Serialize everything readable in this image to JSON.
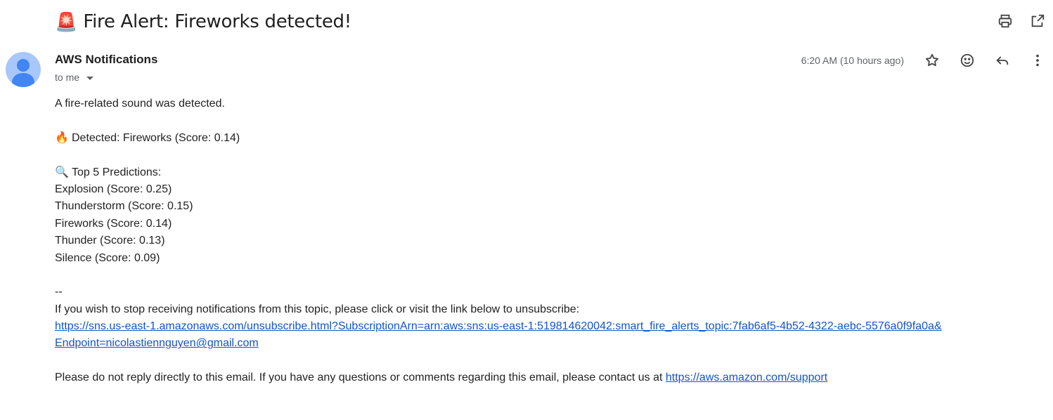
{
  "subject": {
    "emoji": "🚨",
    "title": "Fire Alert: Fireworks detected!"
  },
  "top_actions": [
    {
      "name": "print-all-icon"
    },
    {
      "name": "open-in-new-window-icon"
    }
  ],
  "sender": {
    "name": "AWS Notifications",
    "recipient": "to me",
    "timestamp": "6:20 AM (10 hours ago)"
  },
  "message_actions": [
    {
      "name": "star-icon"
    },
    {
      "name": "emoji-reaction-icon"
    },
    {
      "name": "reply-icon"
    },
    {
      "name": "more-options-icon"
    }
  ],
  "body": {
    "intro": "A fire-related sound was detected.",
    "detected_emoji": "🔥",
    "detected": "Detected: Fireworks (Score: 0.14)",
    "predictions_emoji": "🔍",
    "predictions_header": "Top 5 Predictions:",
    "predictions": [
      "Explosion (Score: 0.25)",
      "Thunderstorm (Score: 0.15)",
      "Fireworks (Score: 0.14)",
      "Thunder (Score: 0.13)",
      "Silence (Score: 0.09)"
    ],
    "separator": "--",
    "unsubscribe_text": "If you wish to stop receiving notifications from this topic, please click or visit the link below to unsubscribe:",
    "unsubscribe_link_line1": "https://sns.us-east-1.amazonaws.com/unsubscribe.html?SubscriptionArn=arn:aws:sns:us-east-1:519814620042:smart_fire_alerts_topic:7fab6af5-4b52-4322-aebc-5576a0f9fa0a&",
    "unsubscribe_link_line2": "Endpoint=nicolastiennguyen@gmail.com",
    "footer_text": "Please do not reply directly to this email. If you have any questions or comments regarding this email, please contact us at ",
    "support_link": "https://aws.amazon.com/support"
  },
  "colors": {
    "link": "#1155cc",
    "avatar_bg": "#a8c7fa",
    "avatar_fg": "#4285f4"
  }
}
